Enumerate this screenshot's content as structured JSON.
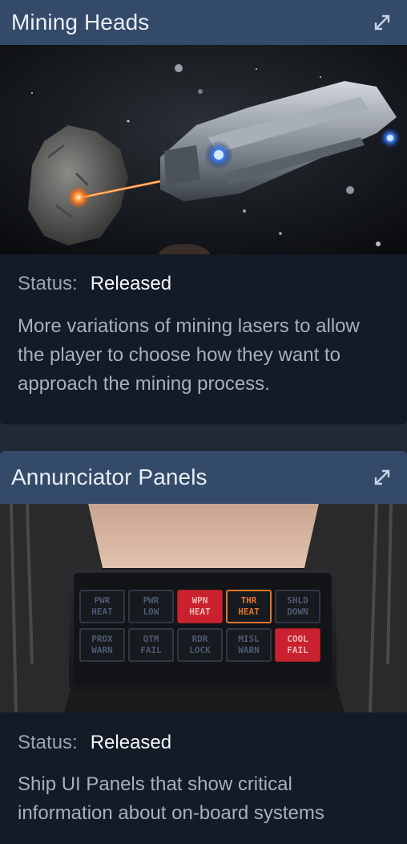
{
  "cards": [
    {
      "title": "Mining Heads",
      "status_label": "Status:",
      "status_value": "Released",
      "description": "More variations of mining lasers to allow the player to choose how they want to approach the mining process.",
      "icons": {
        "expand": "expand-icon"
      }
    },
    {
      "title": "Annunciator Panels",
      "status_label": "Status:",
      "status_value": "Released",
      "description": "Ship UI Panels that show critical information about on-board systems",
      "icons": {
        "expand": "expand-icon"
      },
      "panel_buttons": [
        [
          "PWR",
          "HEAT"
        ],
        [
          "PWR",
          "LOW"
        ],
        [
          "WPN",
          "HEAT"
        ],
        [
          "THR",
          "HEAT"
        ],
        [
          "SHLD",
          "DOWN"
        ],
        [
          "PROX",
          "WARN"
        ],
        [
          "QTM",
          "FAIL"
        ],
        [
          "RDR",
          "LOCK"
        ],
        [
          "MISL",
          "WARN"
        ],
        [
          "COOL",
          "FAIL"
        ]
      ]
    }
  ],
  "colors": {
    "background": "#212836",
    "card": "#141a26",
    "header": "#344a69",
    "status_text": "#9aa4b3",
    "value_text": "#f3f6fb",
    "desc_text": "#a7b0be",
    "alert_red": "#c9222e",
    "alert_orange": "#e2762a"
  }
}
